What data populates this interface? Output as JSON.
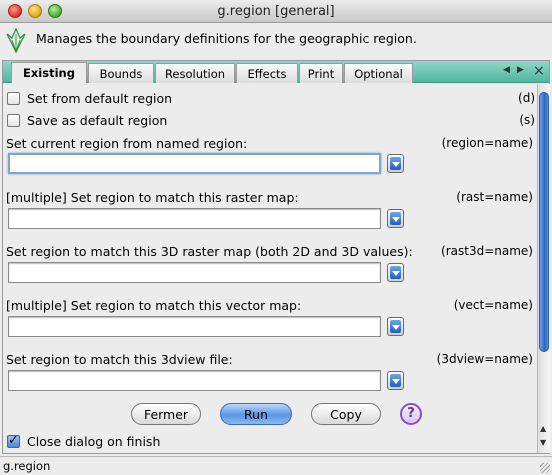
{
  "window": {
    "title": "g.region [general]"
  },
  "description": "Manages the boundary definitions for the geographic region.",
  "tabs": [
    {
      "label": "Existing",
      "active": true
    },
    {
      "label": "Bounds"
    },
    {
      "label": "Resolution"
    },
    {
      "label": "Effects"
    },
    {
      "label": "Print"
    },
    {
      "label": "Optional"
    }
  ],
  "options": {
    "default_region": {
      "label": "Set from default region",
      "flag": "(d)",
      "checked": false
    },
    "save_default": {
      "label": "Save as default region",
      "flag": "(s)",
      "checked": false
    }
  },
  "fields": [
    {
      "label": "Set current region from named region:",
      "param": "(region=name)",
      "value": ""
    },
    {
      "label": "[multiple] Set region to match this raster map:",
      "param": "(rast=name)",
      "value": ""
    },
    {
      "label": "Set region to match this 3D raster map (both 2D and 3D values):",
      "param": "(rast3d=name)",
      "value": ""
    },
    {
      "label": "[multiple] Set region to match this vector map:",
      "param": "(vect=name)",
      "value": ""
    },
    {
      "label": "Set region to match this 3dview file:",
      "param": "(3dview=name)",
      "value": ""
    }
  ],
  "buttons": {
    "close": "Fermer",
    "run": "Run",
    "copy": "Copy",
    "help": "?"
  },
  "close_on_finish": {
    "label": "Close dialog on finish",
    "checked": true
  },
  "status": "g.region",
  "colors": {
    "tab_strip": "#5ec2aa",
    "default_button": "#5a96e4",
    "focus_ring": "#7ba4d8"
  }
}
